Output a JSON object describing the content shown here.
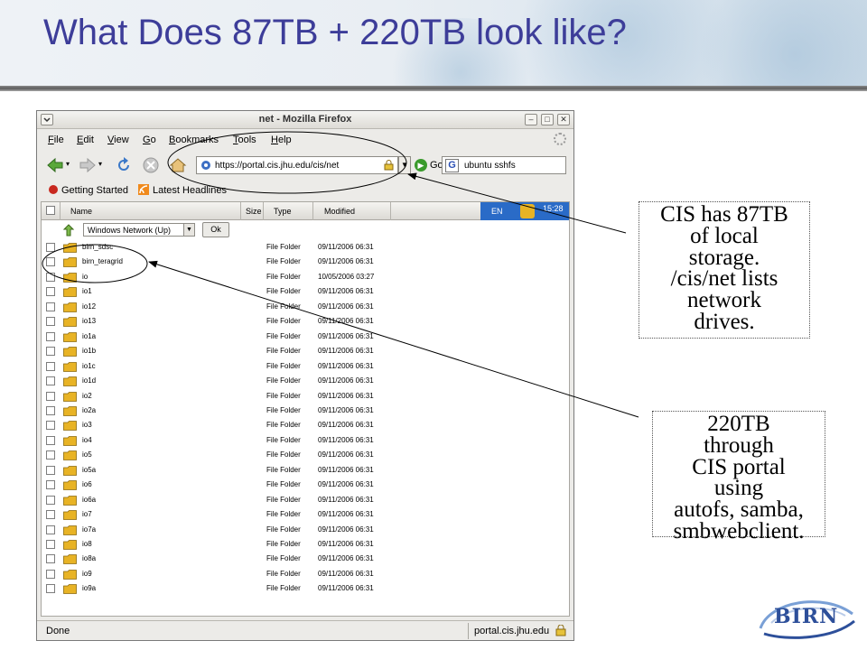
{
  "slide": {
    "title": "What Does 87TB + 220TB look like?"
  },
  "window": {
    "title": "net - Mozilla Firefox",
    "controls": [
      "–",
      "□",
      "✕"
    ],
    "menu": [
      "File",
      "Edit",
      "View",
      "Go",
      "Bookmarks",
      "Tools",
      "Help"
    ],
    "url": "https://portal.cis.jhu.edu/cis/net",
    "go_label": "Go",
    "search_value": "ubuntu sshfs",
    "bookmarks": [
      "Getting Started",
      "Latest Headlines"
    ],
    "status_left": "Done",
    "status_right": "portal.cis.jhu.edu"
  },
  "browser": {
    "columns": [
      "Name",
      "Size",
      "Type",
      "Modified"
    ],
    "lang_label": "EN",
    "clock": "15:28",
    "location_select": "Windows Network (Up)",
    "ok_label": "Ok",
    "rows": [
      {
        "name": "birn_sdsc",
        "type": "File Folder",
        "modified": "09/11/2006 06:31"
      },
      {
        "name": "birn_teragrid",
        "type": "File Folder",
        "modified": "09/11/2006 06:31"
      },
      {
        "name": "io",
        "type": "File Folder",
        "modified": "10/05/2006 03:27"
      },
      {
        "name": "io1",
        "type": "File Folder",
        "modified": "09/11/2006 06:31"
      },
      {
        "name": "io12",
        "type": "File Folder",
        "modified": "09/11/2006 06:31"
      },
      {
        "name": "io13",
        "type": "File Folder",
        "modified": "09/11/2006 06:31"
      },
      {
        "name": "io1a",
        "type": "File Folder",
        "modified": "09/11/2006 06:31"
      },
      {
        "name": "io1b",
        "type": "File Folder",
        "modified": "09/11/2006 06:31"
      },
      {
        "name": "io1c",
        "type": "File Folder",
        "modified": "09/11/2006 06:31"
      },
      {
        "name": "io1d",
        "type": "File Folder",
        "modified": "09/11/2006 06:31"
      },
      {
        "name": "io2",
        "type": "File Folder",
        "modified": "09/11/2006 06:31"
      },
      {
        "name": "io2a",
        "type": "File Folder",
        "modified": "09/11/2006 06:31"
      },
      {
        "name": "io3",
        "type": "File Folder",
        "modified": "09/11/2006 06:31"
      },
      {
        "name": "io4",
        "type": "File Folder",
        "modified": "09/11/2006 06:31"
      },
      {
        "name": "io5",
        "type": "File Folder",
        "modified": "09/11/2006 06:31"
      },
      {
        "name": "io5a",
        "type": "File Folder",
        "modified": "09/11/2006 06:31"
      },
      {
        "name": "io6",
        "type": "File Folder",
        "modified": "09/11/2006 06:31"
      },
      {
        "name": "io6a",
        "type": "File Folder",
        "modified": "09/11/2006 06:31"
      },
      {
        "name": "io7",
        "type": "File Folder",
        "modified": "09/11/2006 06:31"
      },
      {
        "name": "io7a",
        "type": "File Folder",
        "modified": "09/11/2006 06:31"
      },
      {
        "name": "io8",
        "type": "File Folder",
        "modified": "09/11/2006 06:31"
      },
      {
        "name": "io8a",
        "type": "File Folder",
        "modified": "09/11/2006 06:31"
      },
      {
        "name": "io9",
        "type": "File Folder",
        "modified": "09/11/2006 06:31"
      },
      {
        "name": "io9a",
        "type": "File Folder",
        "modified": "09/11/2006 06:31"
      }
    ]
  },
  "callouts": {
    "local_storage": [
      "CIS has 87TB",
      "of local",
      "storage.",
      "/cis/net lists",
      "network",
      "drives."
    ],
    "portal": [
      "220TB",
      "through",
      "CIS portal",
      "using",
      "autofs, samba,",
      "smbwebclient."
    ]
  },
  "logo": {
    "text": "BIRN"
  },
  "colors": {
    "title": "#3d3d99",
    "folder": "#e8b325",
    "lang_bar": "#2a6bc7",
    "logo": "#2d4f9a"
  }
}
